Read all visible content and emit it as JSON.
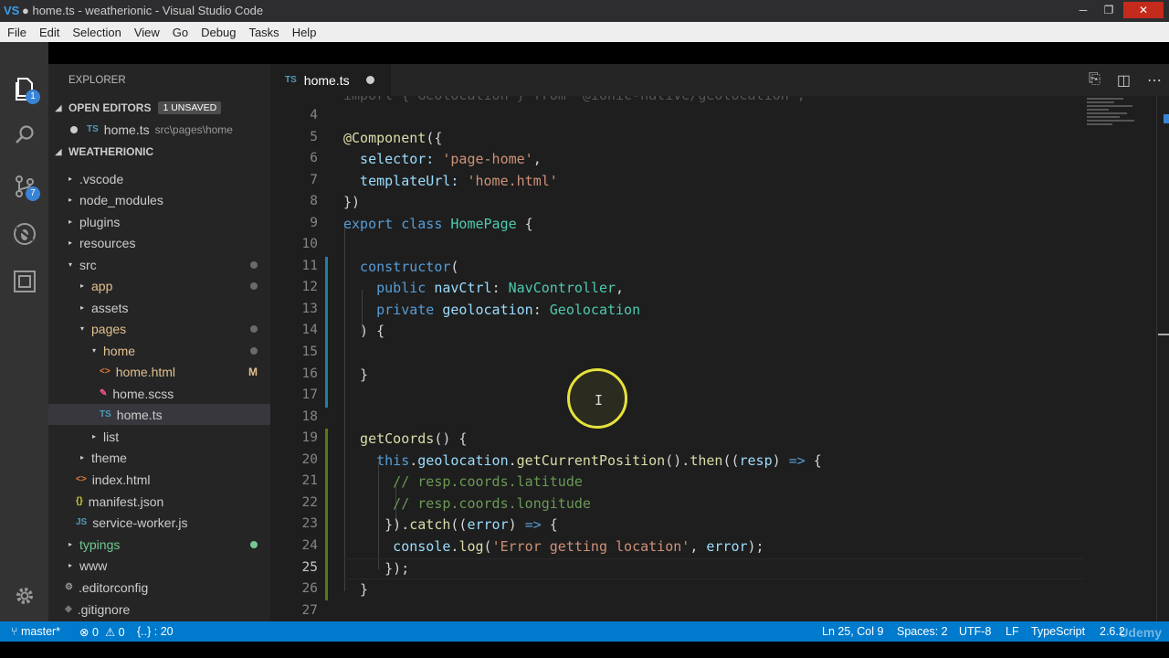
{
  "window": {
    "title": "● home.ts - weatherionic - Visual Studio Code",
    "logo": "VS"
  },
  "menu": [
    "File",
    "Edit",
    "Selection",
    "View",
    "Go",
    "Debug",
    "Tasks",
    "Help"
  ],
  "activity": {
    "explorer_badge": "1",
    "scm_badge": "7"
  },
  "sidebar": {
    "title": "EXPLORER",
    "open_editors_label": "OPEN EDITORS",
    "unsaved_badge": "1 UNSAVED",
    "open_editor": {
      "icon": "TS",
      "name": "home.ts",
      "path": "src\\pages\\home"
    },
    "project_label": "WEATHERIONIC",
    "tree": [
      {
        "label": ".vscode",
        "arrow": "▸"
      },
      {
        "label": "node_modules",
        "arrow": "▸"
      },
      {
        "label": "plugins",
        "arrow": "▸"
      },
      {
        "label": "resources",
        "arrow": "▸"
      },
      {
        "label": "src",
        "arrow": "▾"
      },
      {
        "label": "app",
        "arrow": "▸"
      },
      {
        "label": "assets",
        "arrow": "▸"
      },
      {
        "label": "pages",
        "arrow": "▾"
      },
      {
        "label": "home",
        "arrow": "▾"
      },
      {
        "label": "home.html",
        "icon": "<>",
        "flag": "M"
      },
      {
        "label": "home.scss",
        "icon": "✎"
      },
      {
        "label": "home.ts",
        "icon": "TS"
      },
      {
        "label": "list",
        "arrow": "▸"
      },
      {
        "label": "theme",
        "arrow": "▸"
      },
      {
        "label": "index.html",
        "icon": "<>"
      },
      {
        "label": "manifest.json",
        "icon": "{}"
      },
      {
        "label": "service-worker.js",
        "icon": "JS"
      },
      {
        "label": "typings",
        "arrow": "▸"
      },
      {
        "label": "www",
        "arrow": "▸"
      },
      {
        "label": ".editorconfig",
        "icon": "⚙"
      },
      {
        "label": ".gitignore",
        "icon": "◆"
      }
    ]
  },
  "editor": {
    "tab": {
      "icon": "TS",
      "name": "home.ts"
    },
    "line_numbers": [
      "4",
      "5",
      "6",
      "7",
      "8",
      "9",
      "10",
      "11",
      "12",
      "13",
      "14",
      "15",
      "16",
      "17",
      "18",
      "19",
      "20",
      "21",
      "22",
      "23",
      "24",
      "25",
      "26",
      "27"
    ],
    "partial_line": "import { Geolocation } from '@ionic-native/geolocation';",
    "lines": {
      "l5a": "@Component",
      "l5b": "({",
      "l6a": "  selector: ",
      "l6b": "'page-home'",
      "l6c": ",",
      "l7a": "  templateUrl: ",
      "l7b": "'home.html'",
      "l8": "})",
      "l9a": "export",
      "l9b": " class ",
      "l9c": "HomePage",
      "l9d": " {",
      "l11a": "  constructor",
      "l11b": "(",
      "l12a": "    public ",
      "l12b": "navCtrl",
      "l12c": ": ",
      "l12d": "NavController",
      "l12e": ",",
      "l13a": "    private ",
      "l13b": "geolocation",
      "l13c": ": ",
      "l13d": "Geolocation",
      "l14": "  ) {",
      "l16": "  }",
      "l19a": "  getCoords",
      "l19b": "() {",
      "l20a": "    this",
      "l20b": ".",
      "l20c": "geolocation",
      "l20d": ".",
      "l20e": "getCurrentPosition",
      "l20f": "().",
      "l20g": "then",
      "l20h": "((",
      "l20i": "resp",
      "l20j": ") ",
      "l20k": "=>",
      "l20l": " {",
      "l21": "      // resp.coords.latitude",
      "l22": "      // resp.coords.longitude",
      "l23a": "     }).",
      "l23b": "catch",
      "l23c": "((",
      "l23d": "error",
      "l23e": ") ",
      "l23f": "=>",
      "l23g": " {",
      "l24a": "      console",
      "l24b": ".",
      "l24c": "log",
      "l24d": "(",
      "l24e": "'Error getting location'",
      "l24f": ", ",
      "l24g": "error",
      "l24h": ");",
      "l25": "     });",
      "l26": "  }"
    }
  },
  "status": {
    "branch": "master*",
    "errors": "⊗ 0",
    "warnings": "⚠ 0",
    "symbols": "{..} : 20",
    "position": "Ln 25, Col 9",
    "spaces": "Spaces: 2",
    "encoding": "UTF-8",
    "eol": "LF",
    "language": "TypeScript",
    "version": "2.6.2"
  },
  "watermark": "Udemy"
}
